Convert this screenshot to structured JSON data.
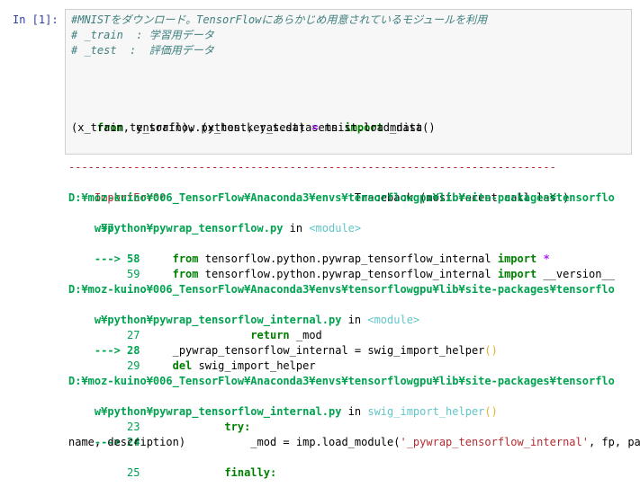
{
  "cell": {
    "prompt": "In [1]:",
    "code": [
      "#MNISTをダウンロード。TensorFlowにあらかじめ用意されているモジュールを利用",
      "# _train  : 学習用データ",
      "# _test  :  評価用データ",
      "",
      "",
      "",
      "",
      "from tensorflow.python.keras.datasets import mnist",
      "(x_train, y_train), (x_test, y_test) = mnist.load_data()"
    ]
  },
  "output": {
    "separator": "---------------------------------------------------------------------------",
    "error_name": "ImportError",
    "traceback_label": "Traceback (most recent call last)",
    "path1a": "D:¥moz-kuino¥006_TensorFlow¥Anaconda3¥envs¥tensorflowgpu¥lib¥site-packages¥tensorflo",
    "path1b": "w¥python¥pywrap_tensorflow.py",
    "in_word": " in ",
    "module_tag": "<module>",
    "l1_57": "     57",
    "l1_58_arrow": "---> 58",
    "l1_58_code_a": "     from",
    "l1_58_code_b": " tensorflow.python.pywrap_tensorflow_internal ",
    "l1_58_code_c": "import",
    "l1_58_code_d": " *",
    "l1_59_num": "     59",
    "l1_59_code_a": "     from",
    "l1_59_code_b": " tensorflow.python.pywrap_tensorflow_internal ",
    "l1_59_code_c": "import",
    "l1_59_code_d": " __version__",
    "path2a": "D:¥moz-kuino¥006_TensorFlow¥Anaconda3¥envs¥tensorflowgpu¥lib¥site-packages¥tensorflo",
    "path2b": "w¥python¥pywrap_tensorflow_internal.py",
    "l2_27_num": "     27",
    "l2_27_code_a": "                 return",
    "l2_27_code_b": " _mod",
    "l2_28_arrow": "---> 28",
    "l2_28_code": "     _pywrap_tensorflow_internal = swig_import_helper",
    "l2_28_paren": "()",
    "l2_29_num": "     29",
    "l2_29_code_a": "     del",
    "l2_29_code_b": " swig_import_helper",
    "path3a": "D:¥moz-kuino¥006_TensorFlow¥Anaconda3¥envs¥tensorflowgpu¥lib¥site-packages¥tensorflo",
    "path3b": "w¥python¥pywrap_tensorflow_internal.py",
    "func_tag": "swig_import_helper",
    "func_paren": "()",
    "l3_23_num": "     23",
    "l3_23_code": "             try:",
    "l3_24_arrow": "---> 24",
    "l3_24_code_a": "                 _mod = imp.load_module(",
    "l3_24_str": "'_pywrap_tensorflow_internal'",
    "l3_24_code_b": ", fp, path",
    "l3_24_cont": "name, description)",
    "l3_25_num": "     25",
    "l3_25_code": "             finally:"
  }
}
